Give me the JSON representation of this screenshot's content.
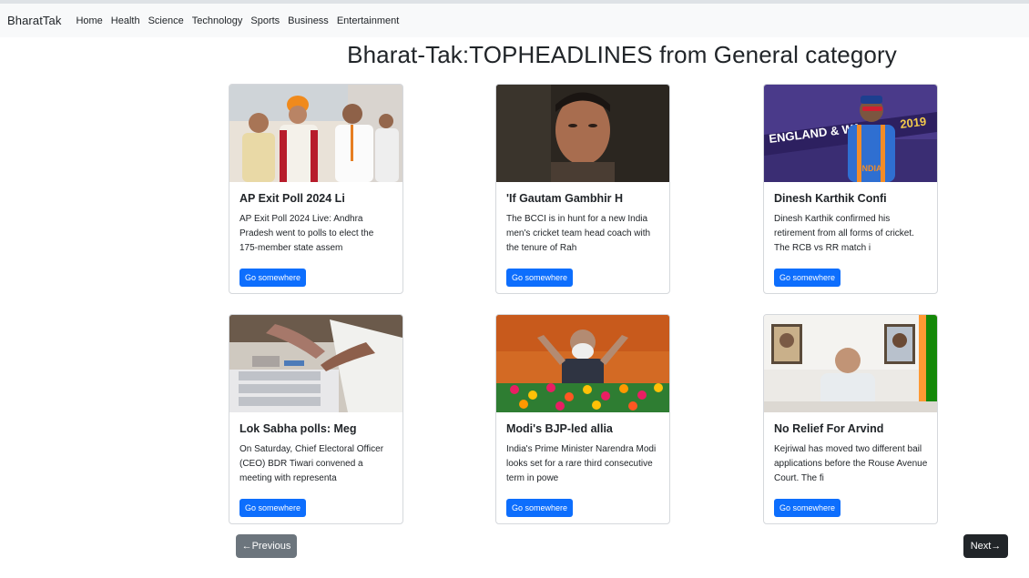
{
  "navbar": {
    "brand": "BharatTak",
    "links": [
      "Home",
      "Health",
      "Science",
      "Technology",
      "Sports",
      "Business",
      "Entertainment"
    ]
  },
  "page": {
    "title": "Bharat-Tak:TOPHEADLINES from General category"
  },
  "cards": [
    {
      "title": "AP Exit Poll 2024 Li",
      "text": "AP Exit Poll 2024 Live: Andhra Pradesh went to polls to elect the 175-member state assem",
      "button": "Go somewhere"
    },
    {
      "title": "'If Gautam Gambhir H",
      "text": "The BCCI is in hunt for a new India men's cricket team head coach with the tenure of Rah",
      "button": "Go somewhere"
    },
    {
      "title": "Dinesh Karthik Confi",
      "text": "Dinesh Karthik confirmed his retirement from all forms of cricket. The RCB vs RR match i",
      "button": "Go somewhere"
    },
    {
      "title": "Lok Sabha polls: Meg",
      "text": "On Saturday, Chief Electoral Officer (CEO) BDR Tiwari convened a meeting with representa",
      "button": "Go somewhere"
    },
    {
      "title": "Modi's BJP-led allia",
      "text": "India's Prime Minister Narendra Modi looks set for a rare third consecutive term in powe",
      "button": "Go somewhere"
    },
    {
      "title": "No Relief For Arvind",
      "text": "Kejriwal has moved two different bail applications before the Rouse Avenue Court. The fi",
      "button": "Go somewhere"
    }
  ],
  "pagination": {
    "previous": "←Previous",
    "next": "Next→"
  }
}
